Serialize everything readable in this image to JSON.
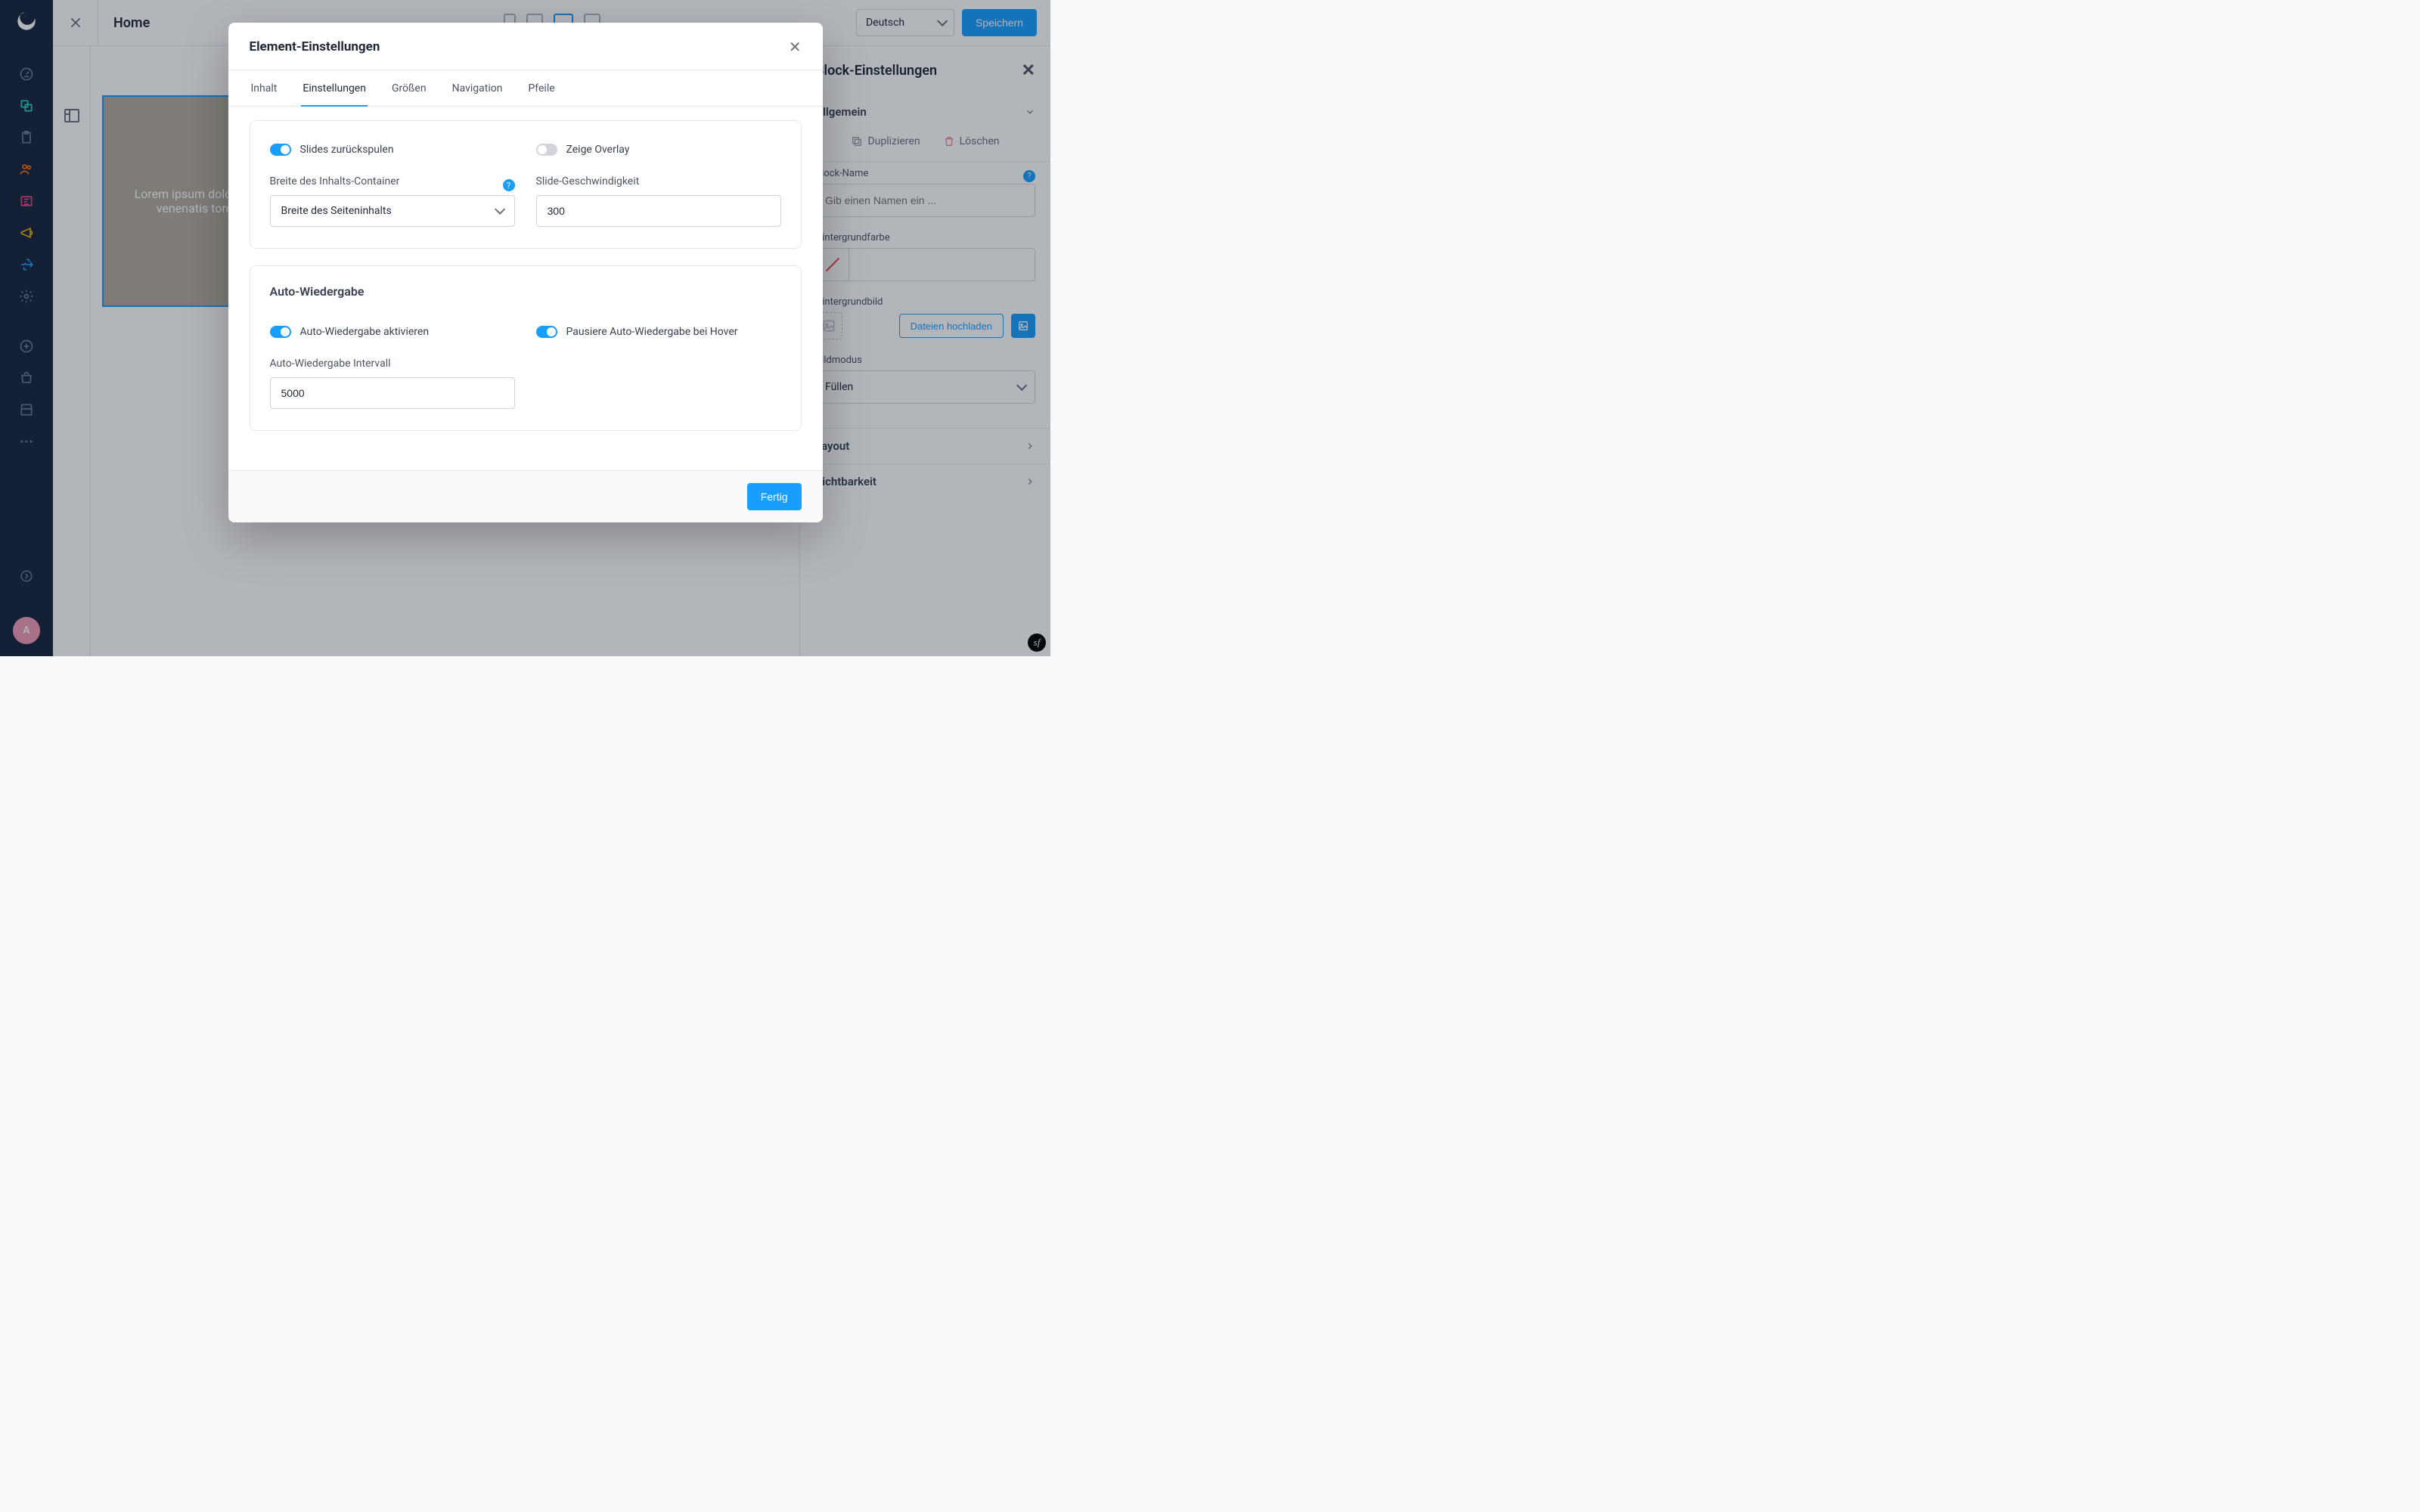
{
  "topbar": {
    "title": "Home",
    "language_selected": "Deutsch",
    "save_label": "Speichern"
  },
  "leftnav": {
    "avatar_initial": "A"
  },
  "block_panel": {
    "title": "Block-Einstellungen",
    "section_general": "Allgemein",
    "duplicate_label": "Duplizieren",
    "delete_label": "Löschen",
    "block_name_label": "Block-Name",
    "block_name_placeholder": "Gib einen Namen ein ...",
    "bg_color_label": "Hintergrundfarbe",
    "bg_image_label": "Hintergrundbild",
    "upload_label": "Dateien hochladen",
    "mode_label": "Bildmodus",
    "mode_value": "Füllen",
    "section_layout": "Layout",
    "section_visibility": "Sichtbarkeit"
  },
  "slider_preview_text": "Lorem ipsum dolor sit amet, tempus venenatis torquent tincidunt",
  "modal": {
    "title": "Element-Einstellungen",
    "tabs": {
      "content": "Inhalt",
      "settings": "Einstellungen",
      "sizes": "Größen",
      "navigation": "Navigation",
      "arrows": "Pfeile"
    },
    "settings": {
      "rewind_label": "Slides zurückspulen",
      "overlay_label": "Zeige Overlay",
      "container_width_label": "Breite des Inhalts-Container",
      "container_width_value": "Breite des Seiteninhalts",
      "slide_speed_label": "Slide-Geschwindigkeit",
      "slide_speed_value": "300",
      "autoplay_section": "Auto-Wiedergabe",
      "autoplay_enable_label": "Auto-Wiedergabe aktivieren",
      "autoplay_pause_label": "Pausiere Auto-Wiedergabe bei Hover",
      "autoplay_interval_label": "Auto-Wiedergabe Intervall",
      "autoplay_interval_value": "5000"
    },
    "done_label": "Fertig"
  }
}
